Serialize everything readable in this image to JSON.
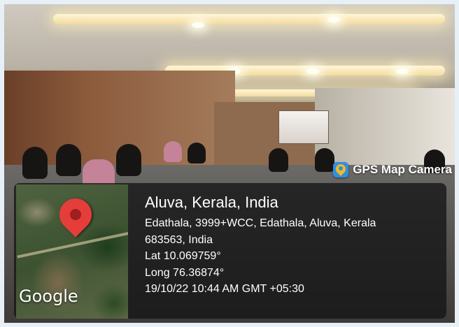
{
  "stamp": {
    "app_name": "GPS Map Camera",
    "icon": "map-camera-icon",
    "icon_color": "#2f8fe0"
  },
  "map": {
    "logo_text": "Google",
    "marker_icon": "location-pin-icon",
    "marker_color": "#e53d3a"
  },
  "location": {
    "place": "Aluva, Kerala, India",
    "address_line1": "Edathala, 3999+WCC, Edathala, Aluva, Kerala",
    "address_line2": "683563, India",
    "latitude": "Lat 10.069759°",
    "longitude": "Long 76.36874°",
    "timestamp": "19/10/22 10:44 AM GMT +05:30"
  },
  "panel_background": "#141416"
}
